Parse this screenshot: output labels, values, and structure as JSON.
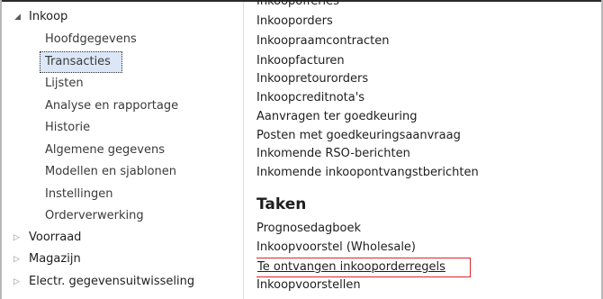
{
  "nav": {
    "inkoop": {
      "label": "Inkoop",
      "expanded": true
    },
    "sub_items": [
      "Hoofdgegevens",
      "Transacties",
      "Lijsten",
      "Analyse en rapportage",
      "Historie",
      "Algemene gegevens",
      "Modellen en sjablonen",
      "Instellingen",
      "Orderverwerking"
    ],
    "selected": "Transacties",
    "collapsed": [
      "Voorraad",
      "Magazijn",
      "Electr. gegevensuitwisseling"
    ]
  },
  "content": {
    "cut_off_top": "Inkoopofferles",
    "links": [
      "Inkooporders",
      "Inkoopraamcontracten",
      "Inkoopfacturen",
      "Inkoopretourorders",
      "Inkoopcreditnota's",
      "Aanvragen ter goedkeuring",
      "Posten met goedkeuringsaanvraag",
      "Inkomende RSO-berichten",
      "Inkomende inkoopontvangstberichten"
    ],
    "taken_heading": "Taken",
    "taken": [
      "Prognosedagboek",
      "Inkoopvoorstel (Wholesale)",
      "Te ontvangen inkooporderregels",
      "Inkoopvoorstellen"
    ],
    "highlight_color": "#d9252a"
  }
}
